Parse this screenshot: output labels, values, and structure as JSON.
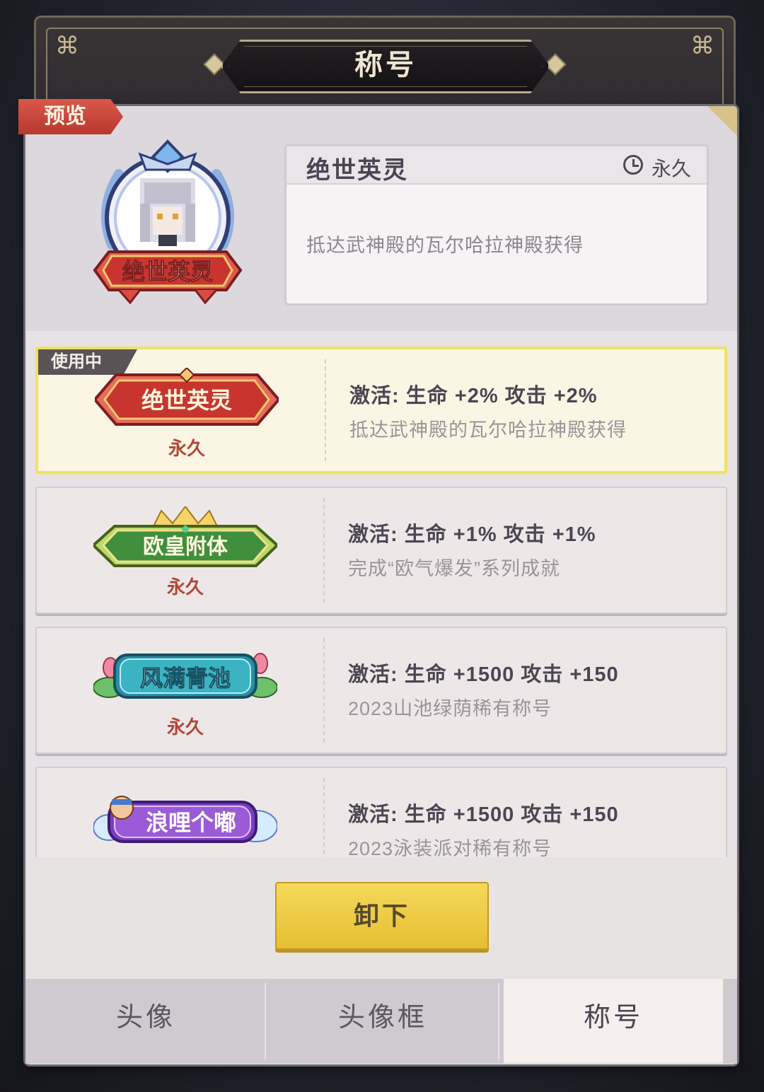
{
  "header": {
    "title": "称号"
  },
  "preview": {
    "ribbon_label": "预览",
    "badge_text": "绝世英灵",
    "card": {
      "title": "绝世英灵",
      "duration": "永久",
      "description": "抵达武神殿的瓦尔哈拉神殿获得"
    }
  },
  "list": {
    "in_use_label": "使用中",
    "items": [
      {
        "badge_text": "绝世英灵",
        "duration": "永久",
        "effect": "激活: 生命  +2%  攻击  +2%",
        "source": "抵达武神殿的瓦尔哈拉神殿获得",
        "active": true
      },
      {
        "badge_text": "欧皇附体",
        "duration": "永久",
        "effect": "激活: 生命  +1%  攻击  +1%",
        "source": "完成“欧气爆发”系列成就",
        "active": false
      },
      {
        "badge_text": "风满青池",
        "duration": "永久",
        "effect": "激活: 生命  +1500  攻击  +150",
        "source": "2023山池绿荫稀有称号",
        "active": false
      },
      {
        "badge_text": "浪哩个嘟",
        "duration": "",
        "effect": "激活: 生命  +1500  攻击  +150",
        "source": "2023泳装派对稀有称号",
        "active": false
      }
    ]
  },
  "footer": {
    "unequip_label": "卸下"
  },
  "tabs": [
    {
      "label": "头像",
      "active": false
    },
    {
      "label": "头像框",
      "active": false
    },
    {
      "label": "称号",
      "active": true
    }
  ],
  "colors": {
    "accent_yellow": "#f1d14a",
    "active_border": "#f1e063",
    "duration_red": "#b0483a",
    "ribbon_red": "#c9463b"
  },
  "icons": [
    "knot-ornament-icon",
    "clock-icon",
    "pixel-character-avatar-icon",
    "crown-icon",
    "lotus-icon",
    "cloud-icon"
  ]
}
